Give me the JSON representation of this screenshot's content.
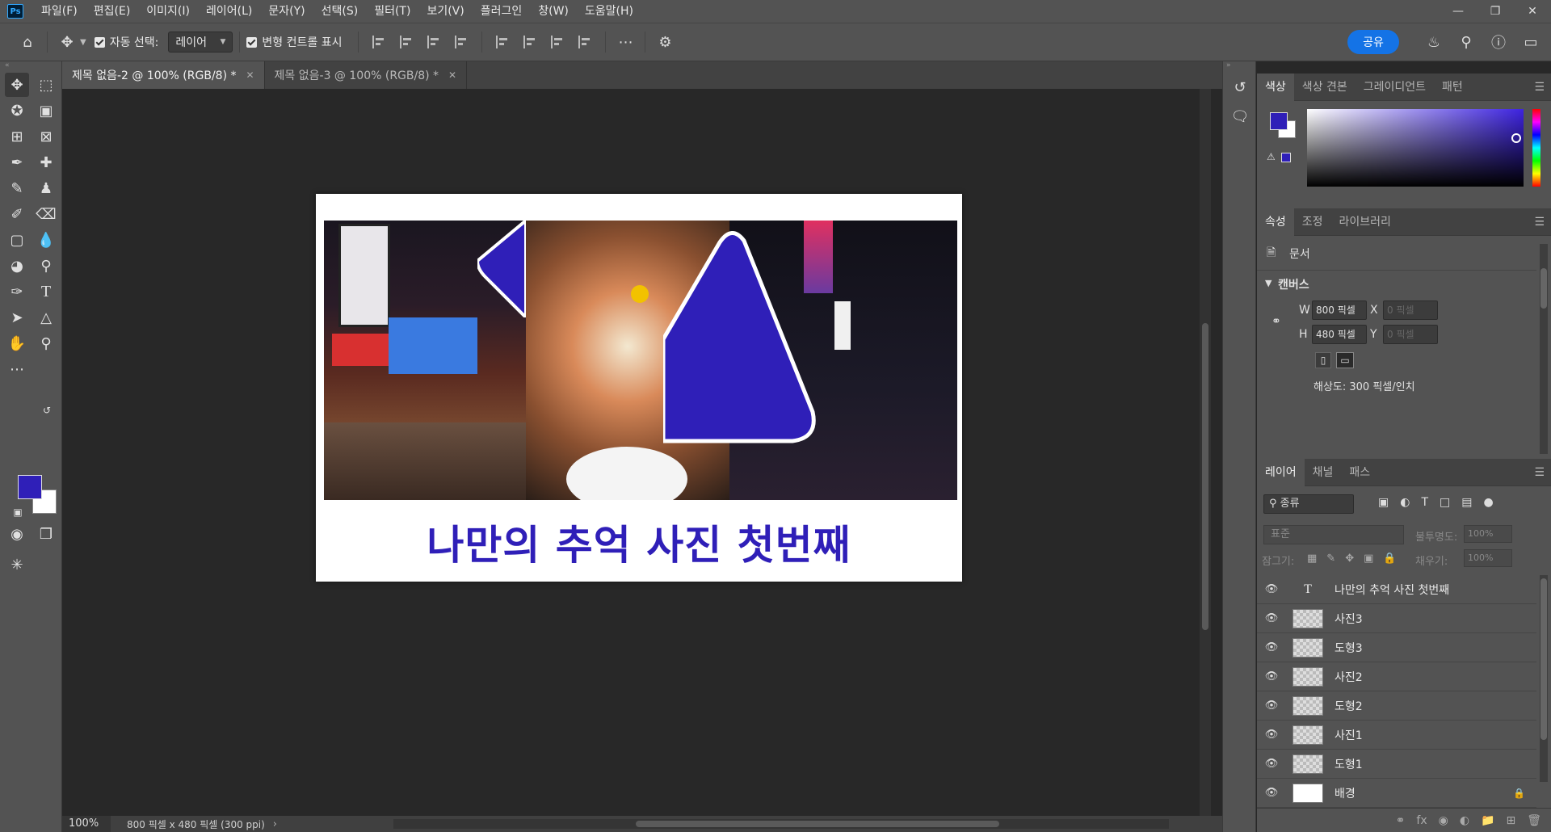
{
  "app": {
    "logo": "Ps"
  },
  "menu": [
    "파일(F)",
    "편집(E)",
    "이미지(I)",
    "레이어(L)",
    "문자(Y)",
    "선택(S)",
    "필터(T)",
    "보기(V)",
    "플러그인",
    "창(W)",
    "도움말(H)"
  ],
  "options": {
    "auto_select_label": "자동 선택:",
    "auto_select_value": "레이어",
    "transform_label": "변형 컨트롤 표시",
    "share_label": "공유"
  },
  "tabs": [
    {
      "label": "제목 없음-2 @ 100% (RGB/8) *",
      "active": true
    },
    {
      "label": "제목 없음-3 @ 100% (RGB/8) *",
      "active": false
    }
  ],
  "document": {
    "title_text": "나만의 추억 사진 첫번째",
    "accent": "#2f1fb8"
  },
  "status": {
    "zoom": "100%",
    "info": "800 픽셀 x 480 픽셀 (300 ppi)"
  },
  "color_panel": {
    "tabs": [
      "색상",
      "색상 견본",
      "그레이디언트",
      "패턴"
    ],
    "foreground": "#2f1fb8",
    "background": "#ffffff"
  },
  "props_panel": {
    "tabs": [
      "속성",
      "조정",
      "라이브러리"
    ],
    "doc_label": "문서",
    "section": "캔버스",
    "w_label": "W",
    "w_value": "800 픽셀",
    "h_label": "H",
    "h_value": "480 픽셀",
    "x_label": "X",
    "x_value": "0 픽셀",
    "y_label": "Y",
    "y_value": "0 픽셀",
    "resolution": "해상도: 300 픽셀/인치"
  },
  "layers_panel": {
    "tabs": [
      "레이어",
      "채널",
      "패스"
    ],
    "filter_value": "종류",
    "blend_mode": "표준",
    "opacity_label": "불투명도:",
    "opacity_value": "100%",
    "lock_label": "잠그기:",
    "fill_label": "채우기:",
    "fill_value": "100%",
    "layers": [
      {
        "name": "나만의 추억 사진 첫번째",
        "kind": "text"
      },
      {
        "name": "사진3",
        "kind": "image"
      },
      {
        "name": "도형3",
        "kind": "shape"
      },
      {
        "name": "사진2",
        "kind": "image"
      },
      {
        "name": "도형2",
        "kind": "shape"
      },
      {
        "name": "사진1",
        "kind": "image"
      },
      {
        "name": "도형1",
        "kind": "shape"
      },
      {
        "name": "배경",
        "kind": "background"
      }
    ]
  }
}
